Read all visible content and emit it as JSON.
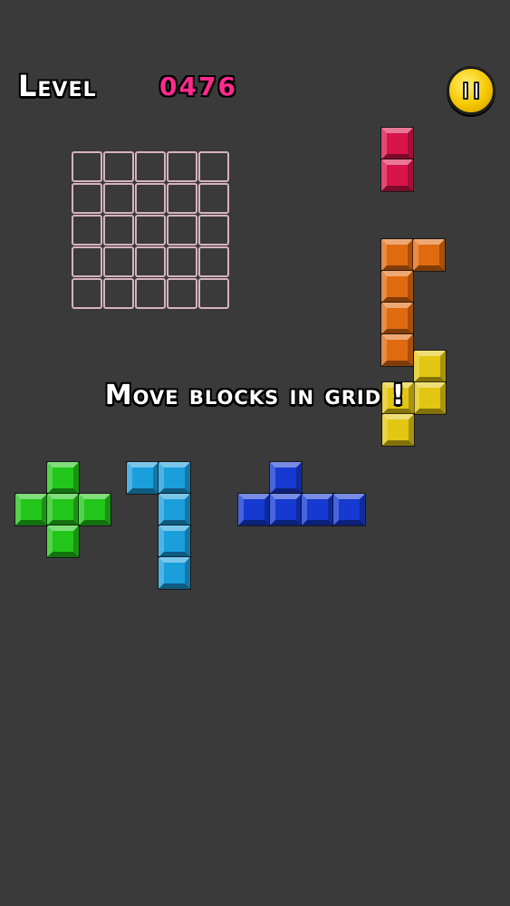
{
  "hud": {
    "level_label": "Level",
    "level_number": "0476",
    "level_number_color": "#ff2a8c",
    "pause_icon": "pause-icon"
  },
  "board": {
    "rows": 5,
    "cols": 5,
    "cell_outline_color": "#d6b3bd"
  },
  "message": {
    "text": "Move blocks in grid !"
  },
  "pieces": [
    {
      "name": "red-i-piece",
      "color": "#d8144a"
    },
    {
      "name": "orange-j-piece",
      "color": "#e06a10"
    },
    {
      "name": "yellow-s-piece",
      "color": "#e3c613"
    },
    {
      "name": "green-plus-piece",
      "color": "#22c51a"
    },
    {
      "name": "cyan-l-piece",
      "color": "#1b9fdc"
    },
    {
      "name": "blue-t-piece",
      "color": "#1539d1"
    }
  ]
}
